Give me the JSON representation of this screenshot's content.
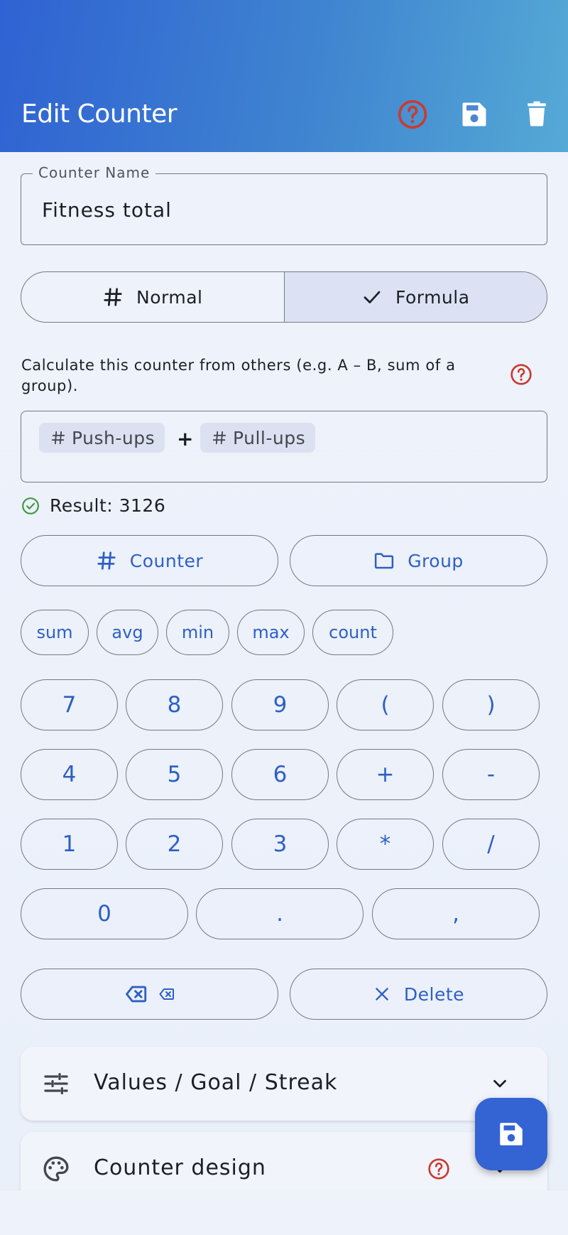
{
  "appbar": {
    "title": "Edit Counter",
    "icons": [
      "help-icon",
      "save-icon",
      "delete-icon"
    ],
    "help_color": "#c93b32"
  },
  "name_field": {
    "label": "Counter Name",
    "value": "Fitness total"
  },
  "mode": {
    "options": [
      {
        "label": "Normal",
        "icon": "hash-icon",
        "selected": false
      },
      {
        "label": "Formula",
        "icon": "check-icon",
        "selected": true
      }
    ]
  },
  "formula": {
    "hint": "Calculate this counter from others (e.g. A – B, sum of a group).",
    "tokens": [
      {
        "label": "Push-ups",
        "icon": "hash-icon"
      },
      {
        "operator": "+"
      },
      {
        "label": "Pull-ups",
        "icon": "hash-icon"
      }
    ],
    "result": "Result: 3126",
    "result_icon": "check-circle-icon"
  },
  "insert_buttons": {
    "counter": "Counter",
    "group": "Group"
  },
  "functions": [
    "sum",
    "avg",
    "min",
    "max",
    "count"
  ],
  "keypad": {
    "rows": [
      [
        "7",
        "8",
        "9",
        "(",
        ")"
      ],
      [
        "4",
        "5",
        "6",
        "+",
        "-"
      ],
      [
        "1",
        "2",
        "3",
        "*",
        "/"
      ],
      [
        "0",
        ".",
        ","
      ]
    ]
  },
  "edit_buttons": {
    "backspace_icon": "backspace-icon",
    "delete": "Delete"
  },
  "sections": [
    {
      "title": "Values / Goal / Streak",
      "icon": "tune-icon"
    },
    {
      "title": "Counter design",
      "icon": "palette-icon"
    }
  ],
  "colors": {
    "accent": "#2f5fc4",
    "appbar_start": "#2f62d3",
    "appbar_end": "#55a9d6",
    "fab": "#3463d3",
    "success": "#3e9a3c"
  }
}
